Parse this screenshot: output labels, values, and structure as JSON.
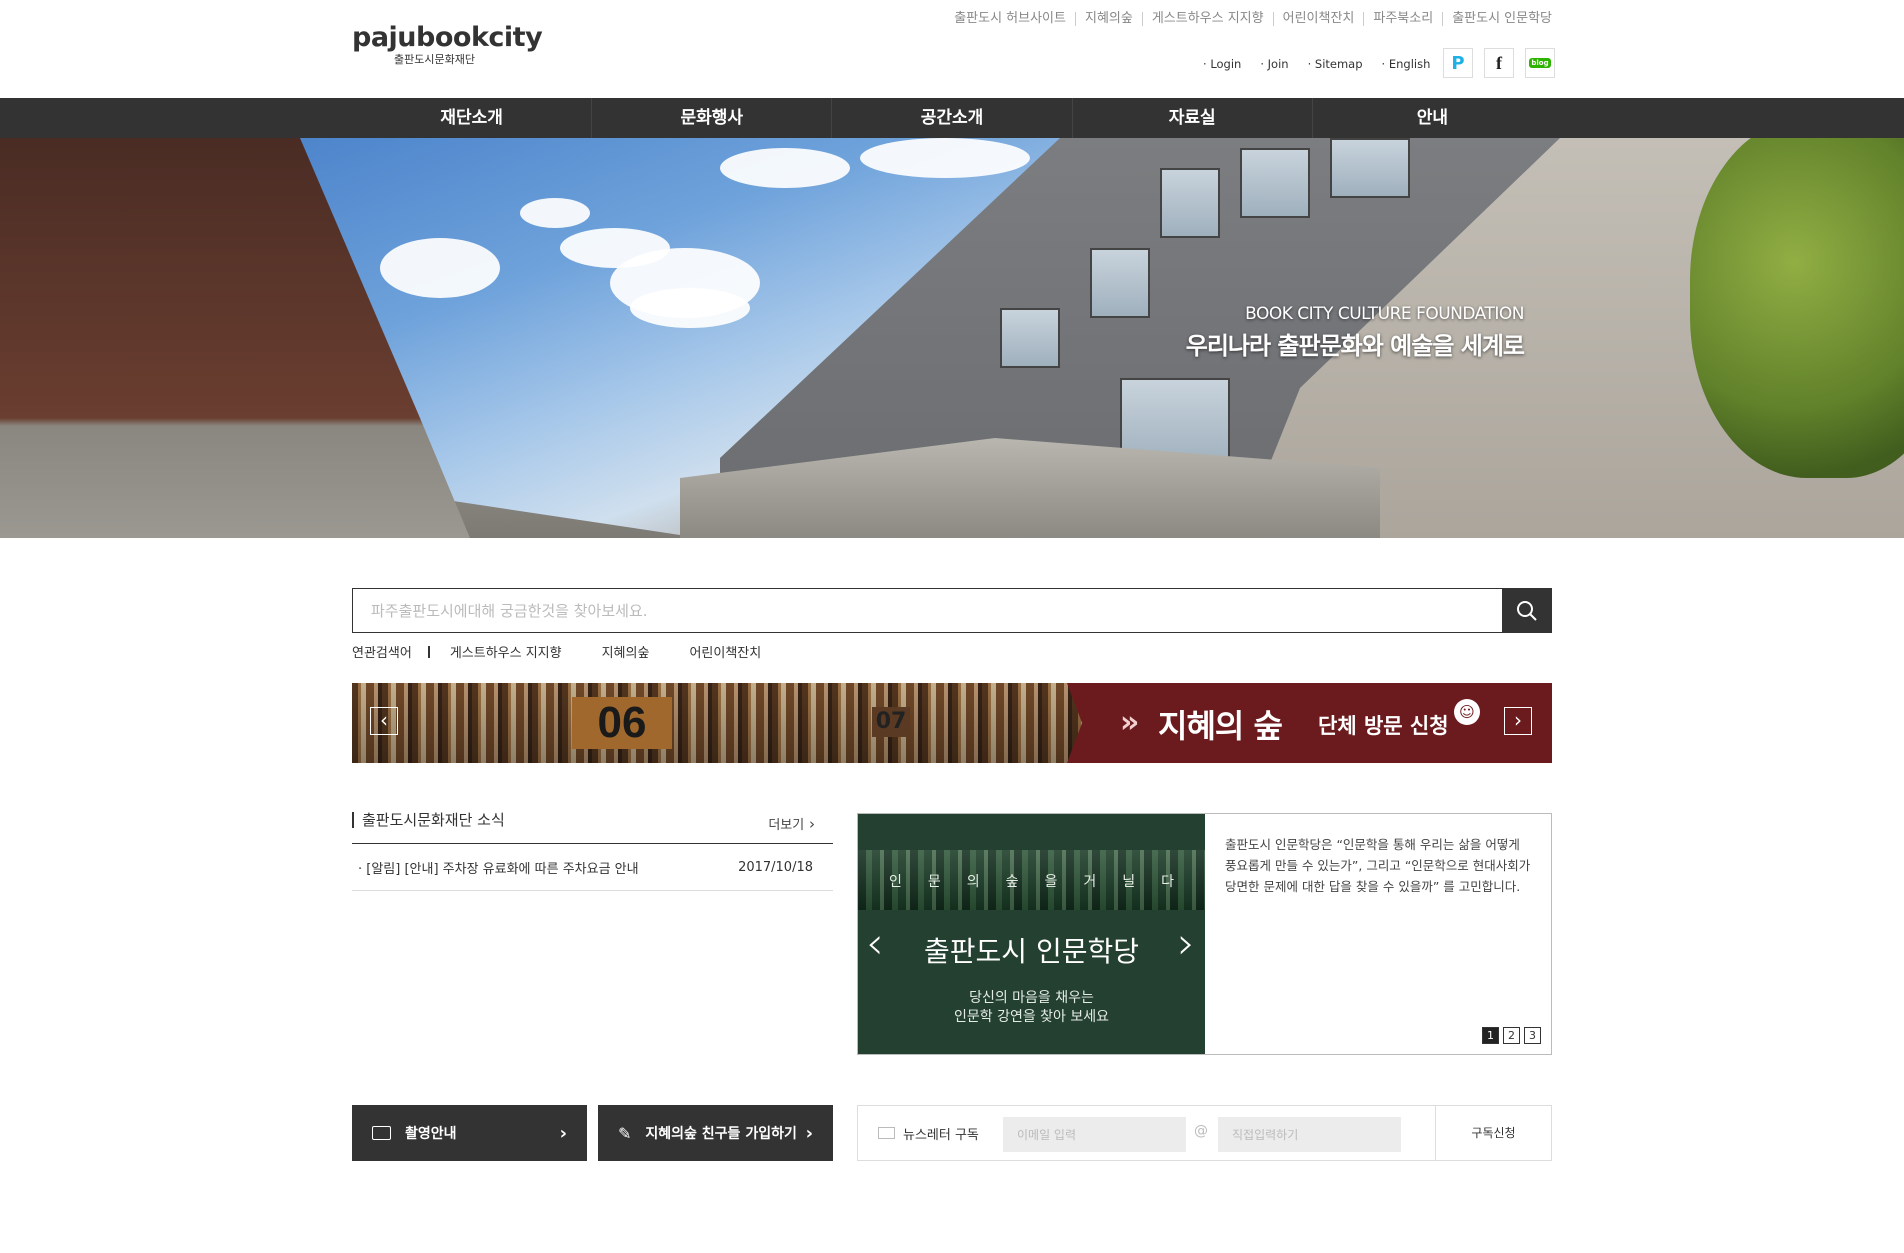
{
  "logo": {
    "main": "pajubookcity",
    "sub": "출판도시문화재단"
  },
  "util_links": [
    "출판도시 허브사이트",
    "지혜의숲",
    "게스트하우스 지지향",
    "어린이책잔치",
    "파주북소리",
    "출판도시 인문학당"
  ],
  "account_links": [
    "Login",
    "Join",
    "Sitemap",
    "English"
  ],
  "sns": [
    "P",
    "f",
    "blog"
  ],
  "gnb": [
    "재단소개",
    "문화행사",
    "공간소개",
    "자료실",
    "안내"
  ],
  "hero": {
    "en": "BOOK CITY CULTURE FOUNDATION",
    "ko": "우리나라 출판문화와 예술을 세계로"
  },
  "search": {
    "placeholder": "파주출판도시에대해 궁금한것을 찾아보세요."
  },
  "related": {
    "label": "연관검색어",
    "keywords": [
      "게스트하우스 지지향",
      "지혜의숲",
      "어린이책잔치"
    ]
  },
  "banner": {
    "num1": "06",
    "num2": "07",
    "arrows": "»",
    "title": "지혜의 숲",
    "subtitle": "단체 방문 신청",
    "prev": "‹",
    "next": "›"
  },
  "news": {
    "title": "출판도시문화재단 소식",
    "more": "더보기",
    "items": [
      {
        "title": "[알림] [안내] 주차장 유료화에 따른 주차요금 안내",
        "date": "2017/10/18"
      }
    ]
  },
  "lecture": {
    "tag": "인문의숲을거닐다",
    "title": "출판도시 인문학당",
    "sub1": "당신의 마음을 채우는",
    "sub2": "인문학 강연을 찾아 보세요",
    "desc": "출판도시 인문학당은 “인문학을 통해 우리는 삶을 어떻게 풍요롭게 만들 수 있는가”, 그리고 “인문학으로 현대사회가 당면한 문제에 대한 답을 찾을 수 있을까” 를 고민합니다.",
    "pages": [
      "1",
      "2",
      "3"
    ],
    "active_page": "1"
  },
  "bottom": {
    "btn1": "촬영안내",
    "btn2": "지혜의숲 친구들 가입하기",
    "newsletter": {
      "label": "뉴스레터 구독",
      "email_placeholder": "이메일 입력",
      "domain_placeholder": "직접입력하기",
      "at": "@",
      "subscribe": "구독신청"
    }
  }
}
